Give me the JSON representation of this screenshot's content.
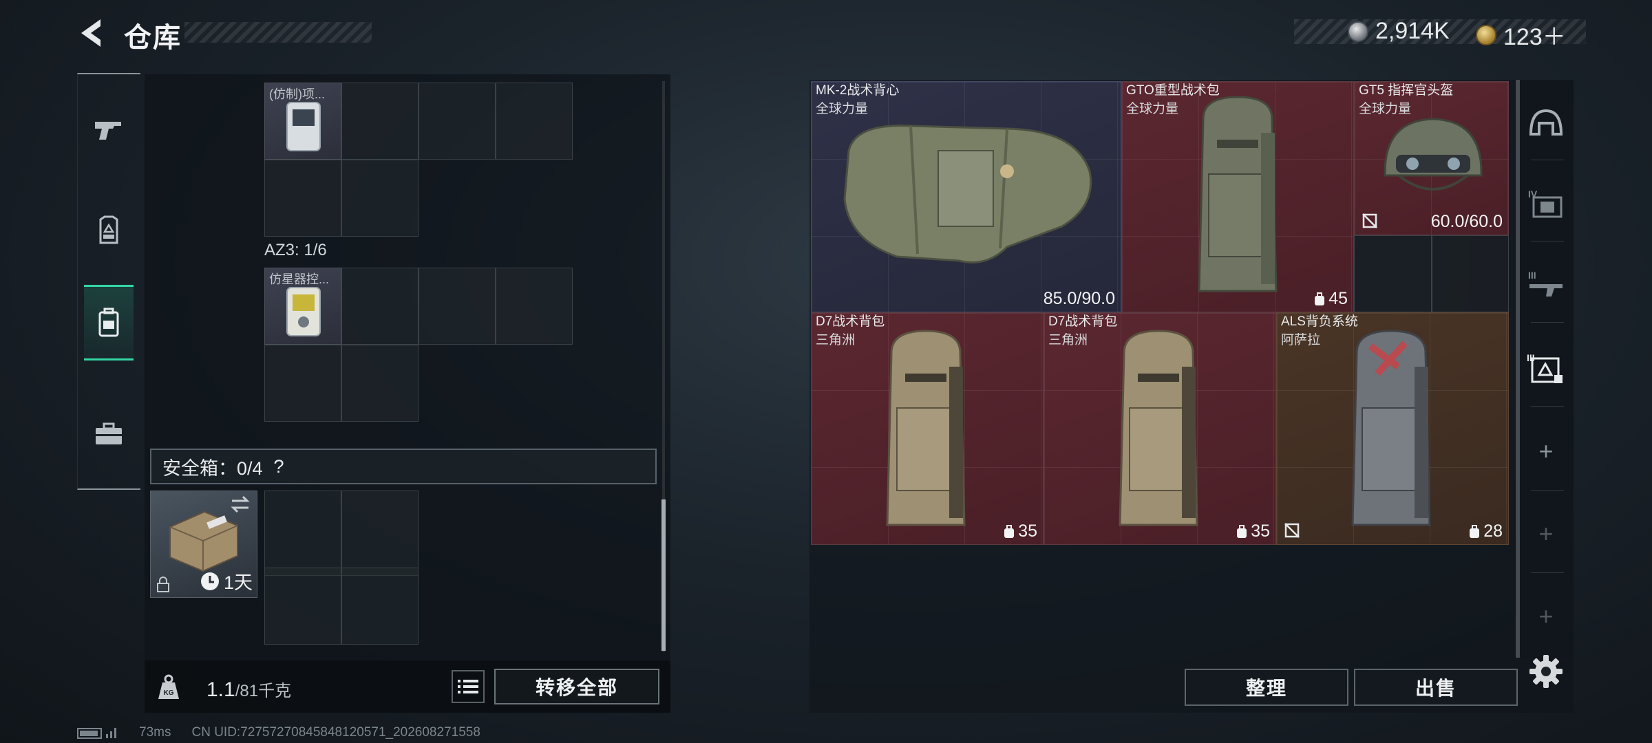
{
  "header": {
    "title": "仓库",
    "currency": [
      {
        "icon": "silver-coin-icon",
        "value": "2,914K"
      },
      {
        "icon": "gold-coin-icon",
        "value": "123＋"
      }
    ]
  },
  "left_nav": {
    "tabs": [
      {
        "icon": "gun-icon"
      },
      {
        "icon": "chest-rig-icon"
      },
      {
        "icon": "backpack-icon",
        "active": true
      },
      {
        "icon": "toolbox-icon"
      }
    ]
  },
  "container": {
    "item1_label": "(仿制)项...",
    "az3_label": "AZ3: 1/6",
    "item2_label": "仿星器控...",
    "safe_box": {
      "label": "安全箱：0/4",
      "help": "?",
      "duration": "1天"
    }
  },
  "footer": {
    "weight": "1.1",
    "weight_cap": "/81千克",
    "transfer_all": "转移全部"
  },
  "equipment": {
    "items": [
      {
        "name": "MK-2战术背心",
        "sub": "全球力量",
        "value": "85.0/90.0",
        "rarity": "purple"
      },
      {
        "name": "GTO重型战术包",
        "sub": "全球力量",
        "count": "45",
        "rarity": "red"
      },
      {
        "name": "GT5 指挥官头盔",
        "sub": "全球力量",
        "value": "60.0/60.0",
        "rarity": "red"
      },
      {
        "name": "D7战术背包",
        "sub": "三角洲",
        "count": "35",
        "rarity": "red"
      },
      {
        "name": "D7战术背包",
        "sub": "三角洲",
        "count": "35",
        "rarity": "red"
      },
      {
        "name": "ALS背负系统",
        "sub": "阿萨拉",
        "count": "28",
        "rarity": "brown"
      }
    ]
  },
  "actions": {
    "sort": "整理",
    "sell": "出售"
  },
  "right_nav": {
    "items": [
      {
        "icon": "helmet-icon"
      },
      {
        "icon": "IV-armor-icon"
      },
      {
        "icon": "III-gun-icon"
      },
      {
        "icon": "III-vest-icon"
      },
      {
        "icon": "add-icon",
        "label": "+"
      },
      {
        "icon": "add-icon",
        "label": "+"
      },
      {
        "icon": "add-icon",
        "label": "+"
      }
    ]
  },
  "status": {
    "ping": "73ms",
    "uid": "CN UID:72757270845848120571_202608271558"
  }
}
